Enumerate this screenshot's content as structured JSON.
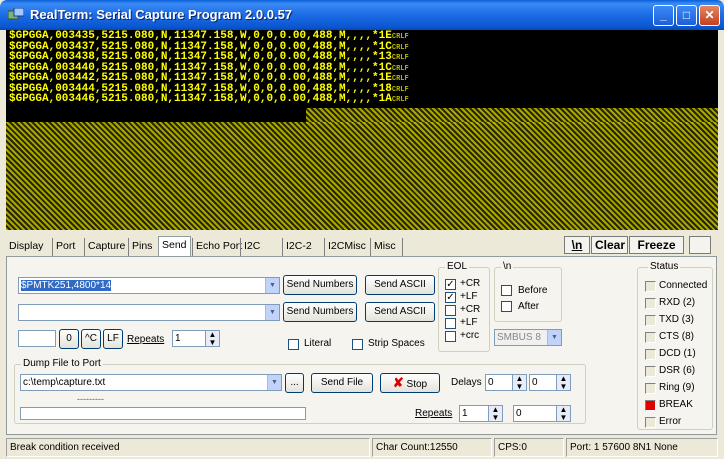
{
  "window": {
    "title": "RealTerm: Serial Capture Program 2.0.0.57",
    "minimize_label": "_",
    "maximize_label": "□",
    "close_label": "✕"
  },
  "terminal": {
    "lines": [
      "$GPGGA,003435,5215.080,N,11347.158,W,0,0,0.00,488,M,,,,*1E",
      "$GPGGA,003437,5215.080,N,11347.158,W,0,0,0.00,488,M,,,,*1C",
      "$GPGGA,003438,5215.080,N,11347.158,W,0,0,0.00,488,M,,,,*13",
      "$GPGGA,003440,5215.080,N,11347.158,W,0,0,0.00,488,M,,,,*1C",
      "$GPGGA,003442,5215.080,N,11347.158,W,0,0,0.00,488,M,,,,*1E",
      "$GPGGA,003444,5215.080,N,11347.158,W,0,0,0.00,488,M,,,,*18",
      "$GPGGA,003446,5215.080,N,11347.158,W,0,0,0.00,488,M,,,,*1A"
    ],
    "line_end": "CRLF",
    "text_color": "#ffff00",
    "background": "#000000"
  },
  "tabs": {
    "items": [
      "Display",
      "Port",
      "Capture",
      "Pins",
      "Send",
      "Echo Port",
      "I2C",
      "I2C-2",
      "I2CMisc",
      "Misc"
    ],
    "active": "Send"
  },
  "toolbar": {
    "newline_label": "\\n",
    "clear_label": "Clear",
    "freeze_label": "Freeze"
  },
  "send": {
    "input1_value": "$PMTK251,4800*14",
    "input2_value": "",
    "send_numbers_label": "Send Numbers",
    "send_ascii_label": "Send ASCII",
    "char_value": "0",
    "ctrl_c_label": "^C",
    "lf_label": "LF",
    "repeats_label": "Repeats",
    "repeats_value": "1",
    "literal_label": "Literal",
    "strip_spaces_label": "Strip Spaces"
  },
  "eol": {
    "label": "EOL",
    "rows": [
      {
        "label": "+CR",
        "checked": true
      },
      {
        "label": "+LF",
        "checked": true
      },
      {
        "label": "+CR",
        "checked": false
      },
      {
        "label": "+LF",
        "checked": false
      },
      {
        "label": "+crc",
        "checked": false
      }
    ]
  },
  "backslash_n": {
    "label": "\\n",
    "before_label": "Before",
    "after_label": "After",
    "smbus_value": "SMBUS 8"
  },
  "dump": {
    "label": "Dump File to Port",
    "path_value": "c:\\temp\\capture.txt",
    "browse_label": "...",
    "send_file_label": "Send File",
    "stop_label": "Stop",
    "delays_label": "Delays",
    "delay1_value": "0",
    "delay2_value": "0",
    "repeats_label": "Repeats",
    "repeats1_value": "1",
    "repeats2_value": "0",
    "progress_text": "---------"
  },
  "status": {
    "label": "Status",
    "items": [
      {
        "label": "Connected",
        "on": false
      },
      {
        "label": "RXD (2)",
        "on": false
      },
      {
        "label": "TXD (3)",
        "on": false
      },
      {
        "label": "CTS (8)",
        "on": false
      },
      {
        "label": "DCD (1)",
        "on": false
      },
      {
        "label": "DSR (6)",
        "on": false
      },
      {
        "label": "Ring (9)",
        "on": false
      },
      {
        "label": "BREAK",
        "on": true
      },
      {
        "label": "Error",
        "on": false
      }
    ],
    "led_on_color": "#e00000"
  },
  "statusbar": {
    "message": "Break condition received",
    "char_count": "Char Count:12550",
    "cps": "CPS:0",
    "port": "Port: 1 57600 8N1 None"
  }
}
